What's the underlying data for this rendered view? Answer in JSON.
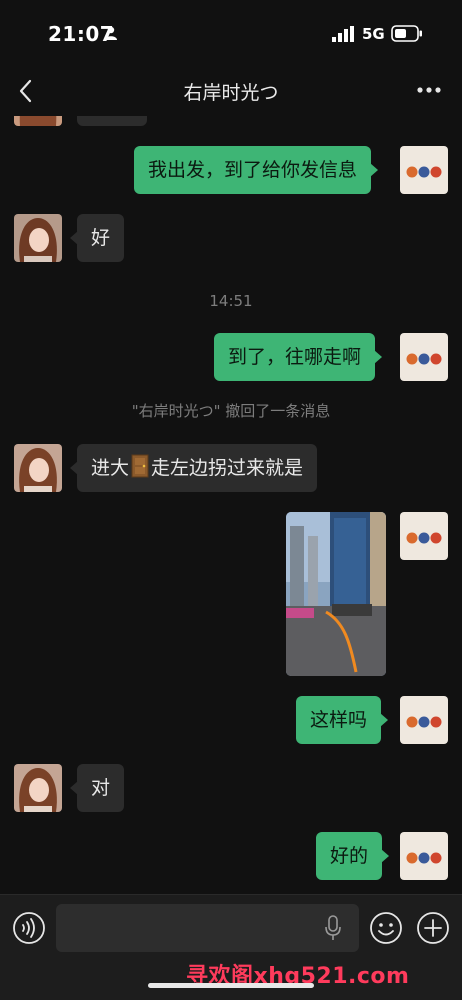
{
  "status": {
    "time": "21:07",
    "network": "5G"
  },
  "nav": {
    "title": "右岸时光つ"
  },
  "messages": {
    "m1": "我出发，到了给你发信息",
    "m2": "好",
    "time1": "14:51",
    "m3": "到了，往哪走啊",
    "recall": "\"右岸时光つ\" 撤回了一条消息",
    "m4_a": "进大",
    "m4_b": "走左边拐过来就是",
    "m5": "这样吗",
    "m6": "对",
    "m7": "好的"
  },
  "input": {
    "value": ""
  },
  "watermark": "寻欢阁xhg521.com",
  "colors": {
    "outgoing_bubble": "#3eb575",
    "incoming_bubble": "#2c2c2c",
    "background": "#111111"
  }
}
